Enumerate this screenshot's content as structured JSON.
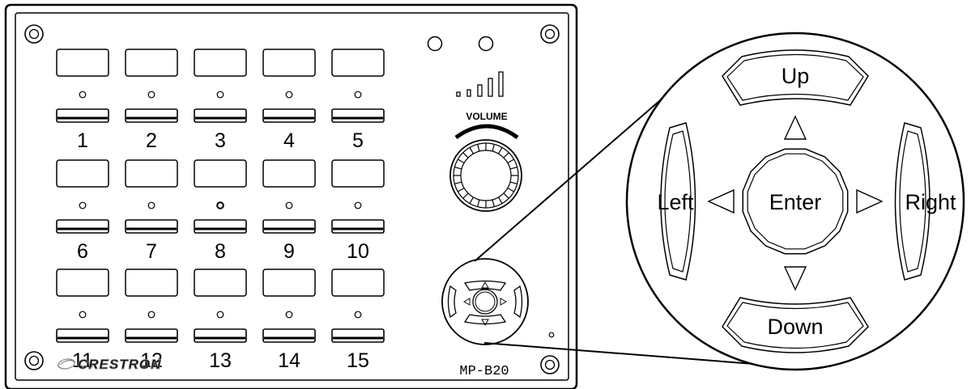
{
  "panel": {
    "buttons": [
      {
        "label": "1"
      },
      {
        "label": "2"
      },
      {
        "label": "3"
      },
      {
        "label": "4"
      },
      {
        "label": "5"
      },
      {
        "label": "6"
      },
      {
        "label": "7"
      },
      {
        "label": "8"
      },
      {
        "label": "9"
      },
      {
        "label": "10"
      },
      {
        "label": "11"
      },
      {
        "label": "12"
      },
      {
        "label": "13"
      },
      {
        "label": "14"
      },
      {
        "label": "15"
      }
    ],
    "volume_label": "VOLUME",
    "brand": "CRESTRON",
    "model": "MP-B20"
  },
  "nav_pad": {
    "up": "Up",
    "down": "Down",
    "left": "Left",
    "right": "Right",
    "enter": "Enter"
  },
  "colors": {
    "line": "#000000",
    "background": "#ffffff"
  }
}
